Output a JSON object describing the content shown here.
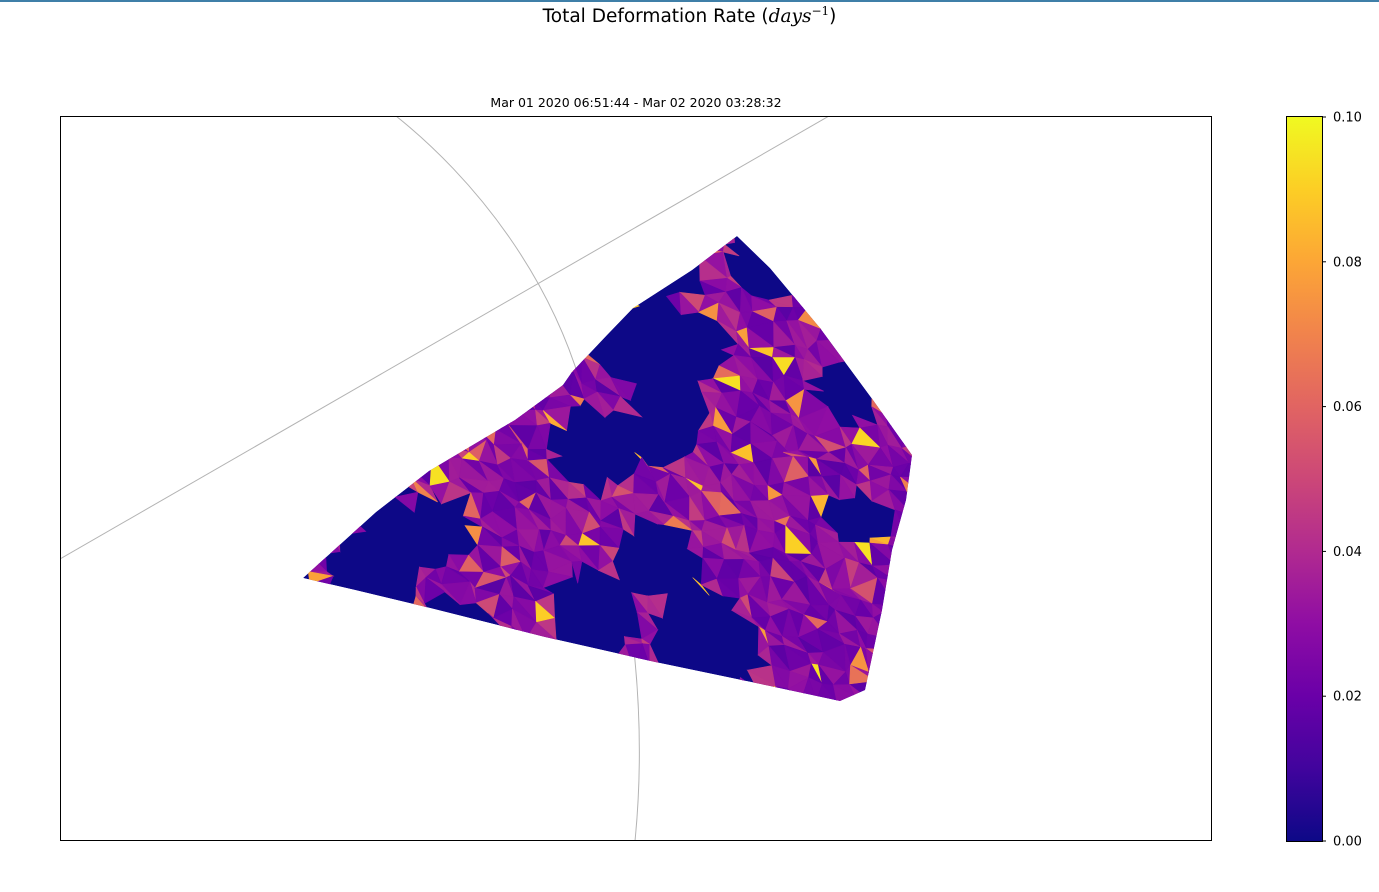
{
  "chart_data": {
    "type": "heatmap",
    "title": "Total Deformation Rate",
    "title_unit_base": "days",
    "title_unit_exponent": "−1",
    "subtitle": "Mar 01 2020 06:51:44 - Mar 02 2020 03:28:32",
    "colormap": "plasma",
    "colormap_stops": [
      "#0d0887",
      "#41049d",
      "#6a00a8",
      "#8f0da4",
      "#b12a90",
      "#cc4778",
      "#e16462",
      "#f1834c",
      "#fca636",
      "#fcce25",
      "#f0f921"
    ],
    "colorbar": {
      "min": 0.0,
      "max": 0.1,
      "ticks": [
        0.0,
        0.02,
        0.04,
        0.06,
        0.08,
        0.1
      ],
      "tick_labels": [
        "0.00",
        "0.02",
        "0.04",
        "0.06",
        "0.08",
        "0.10"
      ]
    },
    "grid": "graticule",
    "frame_color": "#000000",
    "graticule_color": "#b3b3b3"
  }
}
